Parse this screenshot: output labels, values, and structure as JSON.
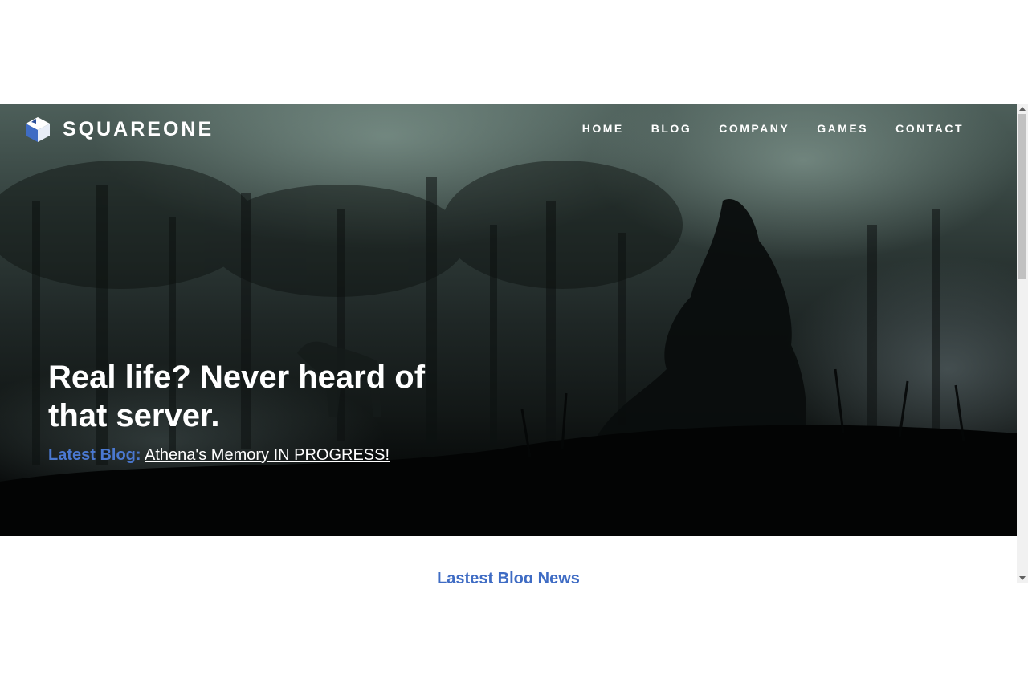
{
  "brand": {
    "name": "SQUAREONE",
    "logo_icon": "cube-logo-icon",
    "accent": "#4a78d0"
  },
  "nav": {
    "items": [
      {
        "label": "HOME"
      },
      {
        "label": "BLOG"
      },
      {
        "label": "COMPANY"
      },
      {
        "label": "GAMES"
      },
      {
        "label": "CONTACT"
      }
    ]
  },
  "hero": {
    "headline": "Real life? Never heard of that server.",
    "latest_label": "Latest Blog:",
    "latest_link": "Athena's Memory IN PROGRESS!"
  },
  "section": {
    "title": "Lastest Blog News"
  }
}
